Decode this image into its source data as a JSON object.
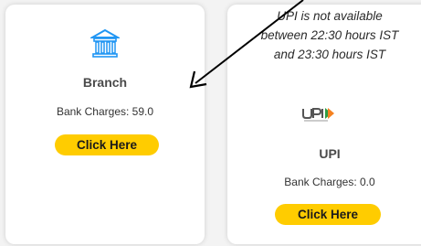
{
  "branch": {
    "icon": "bank-building-icon",
    "title": "Branch",
    "charges": "Bank Charges: 59.0",
    "button": "Click Here"
  },
  "upi": {
    "notice_line1": "UPI is not available",
    "notice_line2": "between 22:30 hours IST",
    "notice_line3": "and 23:30 hours IST",
    "logo": "upi-logo",
    "title": "UPI",
    "charges": "Bank Charges: 0.0",
    "button": "Click Here"
  },
  "colors": {
    "accent_button": "#ffcc00",
    "icon_blue": "#2196f3"
  }
}
